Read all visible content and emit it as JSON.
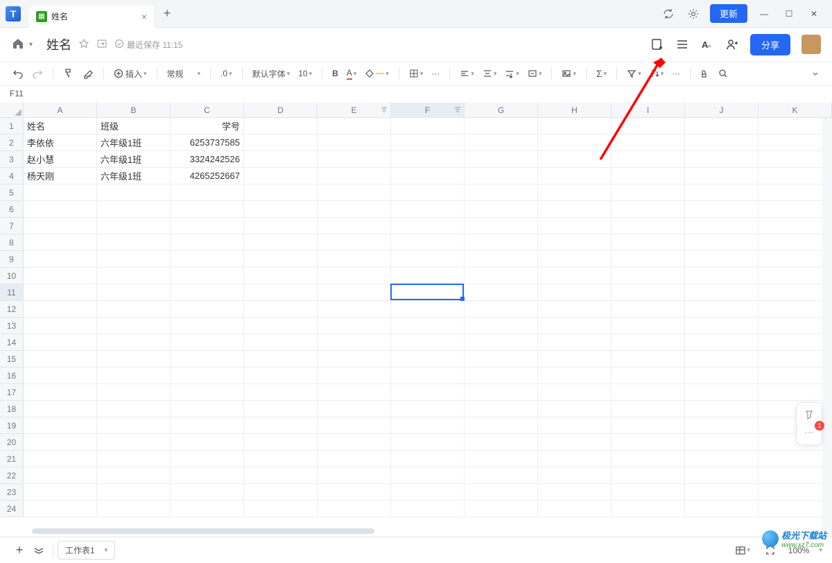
{
  "titlebar": {
    "tab_title": "姓名",
    "update_label": "更新"
  },
  "header": {
    "doc_title": "姓名",
    "saved_text": "最近保存 11:15",
    "share_label": "分享"
  },
  "toolbar": {
    "insert_label": "插入",
    "format_label": "常规",
    "decimal": ".0",
    "font_label": "默认字体",
    "font_size": "10",
    "more": "···"
  },
  "cell_ref": "F11",
  "columns": [
    "A",
    "B",
    "C",
    "D",
    "E",
    "F",
    "G",
    "H",
    "I",
    "J",
    "K"
  ],
  "row_count": 24,
  "selected_row": 11,
  "selected_col_idx": 5,
  "data": {
    "1": {
      "A": "姓名",
      "B": "班级",
      "C": "学号"
    },
    "2": {
      "A": "李依依",
      "B": "六年级1班",
      "C": "6253737585"
    },
    "3": {
      "A": "赵小慧",
      "B": "六年级1班",
      "C": "3324242526"
    },
    "4": {
      "A": "杨天刚",
      "B": "六年级1班",
      "C": "4265252667"
    }
  },
  "footer": {
    "sheet_name": "工作表1",
    "zoom": "100%",
    "badge": "1"
  },
  "watermark": {
    "text1": "极光下载站",
    "text2": "www.xz7.com"
  }
}
